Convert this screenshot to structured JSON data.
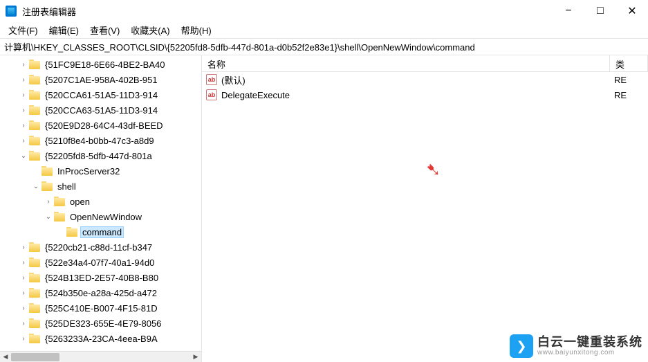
{
  "window": {
    "title": "注册表编辑器",
    "minimize": "−",
    "maximize": "□",
    "close": "✕"
  },
  "menu": {
    "file": "文件(F)",
    "edit": "编辑(E)",
    "view": "查看(V)",
    "favorites": "收藏夹(A)",
    "help": "帮助(H)"
  },
  "address": "计算机\\HKEY_CLASSES_ROOT\\CLSID\\{52205fd8-5dfb-447d-801a-d0b52f2e83e1}\\shell\\OpenNewWindow\\command",
  "tree": [
    {
      "indent": 1,
      "arrow": ">",
      "label": "{51FC9E18-6E66-4BE2-BA40"
    },
    {
      "indent": 1,
      "arrow": ">",
      "label": "{5207C1AE-958A-402B-951"
    },
    {
      "indent": 1,
      "arrow": ">",
      "label": "{520CCA61-51A5-11D3-914"
    },
    {
      "indent": 1,
      "arrow": ">",
      "label": "{520CCA63-51A5-11D3-914"
    },
    {
      "indent": 1,
      "arrow": ">",
      "label": "{520E9D28-64C4-43df-BEED"
    },
    {
      "indent": 1,
      "arrow": ">",
      "label": "{5210f8e4-b0bb-47c3-a8d9"
    },
    {
      "indent": 1,
      "arrow": "v",
      "label": "{52205fd8-5dfb-447d-801a"
    },
    {
      "indent": 2,
      "arrow": "",
      "label": "InProcServer32"
    },
    {
      "indent": 2,
      "arrow": "v",
      "label": "shell"
    },
    {
      "indent": 3,
      "arrow": ">",
      "label": "open"
    },
    {
      "indent": 3,
      "arrow": "v",
      "label": "OpenNewWindow"
    },
    {
      "indent": 4,
      "arrow": "",
      "label": "command",
      "selected": true
    },
    {
      "indent": 1,
      "arrow": ">",
      "label": "{5220cb21-c88d-11cf-b347"
    },
    {
      "indent": 1,
      "arrow": ">",
      "label": "{522e34a4-07f7-40a1-94d0"
    },
    {
      "indent": 1,
      "arrow": ">",
      "label": "{524B13ED-2E57-40B8-B80"
    },
    {
      "indent": 1,
      "arrow": ">",
      "label": "{524b350e-a28a-425d-a472"
    },
    {
      "indent": 1,
      "arrow": ">",
      "label": "{525C410E-B007-4F15-81D"
    },
    {
      "indent": 1,
      "arrow": ">",
      "label": "{525DE323-655E-4E79-8056"
    },
    {
      "indent": 1,
      "arrow": ">",
      "label": "{5263233A-23CA-4eea-B9A"
    }
  ],
  "list": {
    "columns": {
      "name": "名称",
      "type": "类"
    },
    "rows": [
      {
        "name": "(默认)",
        "type": "RE"
      },
      {
        "name": "DelegateExecute",
        "type": "RE"
      }
    ]
  },
  "watermark": {
    "cn": "白云一键重装系统",
    "url": "www.baiyunxitong.com"
  }
}
